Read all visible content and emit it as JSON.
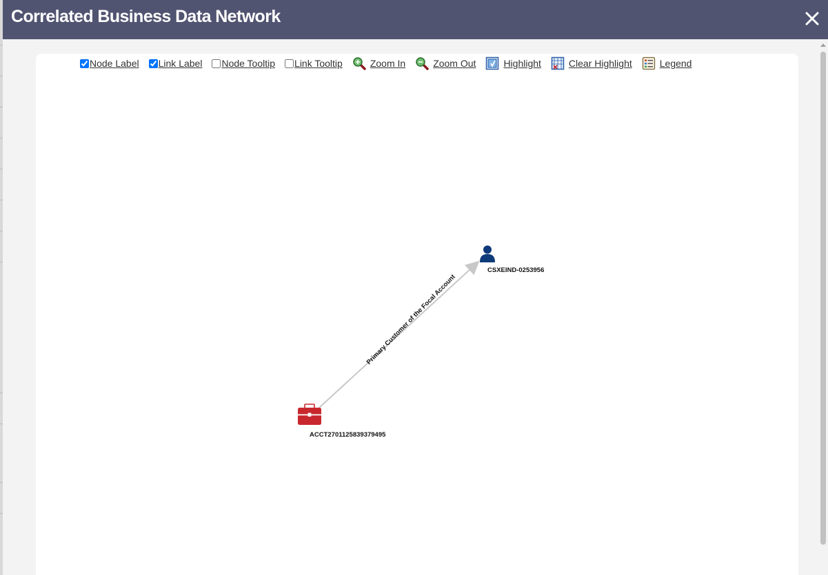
{
  "modal": {
    "title": "Correlated Business Data Network"
  },
  "toolbar": {
    "node_label": {
      "label": "Node Label",
      "checked": true
    },
    "link_label": {
      "label": "Link Label",
      "checked": true
    },
    "node_tooltip": {
      "label": "Node Tooltip",
      "checked": false
    },
    "link_tooltip": {
      "label": "Link Tooltip",
      "checked": false
    },
    "zoom_in": {
      "label": " Zoom In",
      "icon": "zoom-in-icon"
    },
    "zoom_out": {
      "label": " Zoom Out",
      "icon": "zoom-out-icon"
    },
    "highlight": {
      "label": " Highlight",
      "icon": "highlight-icon"
    },
    "clear_highlight": {
      "label": " Clear Highlight",
      "icon": "clear-highlight-icon"
    },
    "legend": {
      "label": " Legend",
      "icon": "legend-icon"
    }
  },
  "network": {
    "nodes": [
      {
        "id": "account",
        "label": "ACCT2701125839379495",
        "icon": "briefcase-icon",
        "color": "#c8282d"
      },
      {
        "id": "customer",
        "label": "CSXEIND-0253956",
        "icon": "person-icon",
        "color": "#0e3a7a"
      }
    ],
    "links": [
      {
        "source": "account",
        "target": "customer",
        "label": "Primary Customer of the Focal Account",
        "color": "#c8c8c8"
      }
    ]
  }
}
